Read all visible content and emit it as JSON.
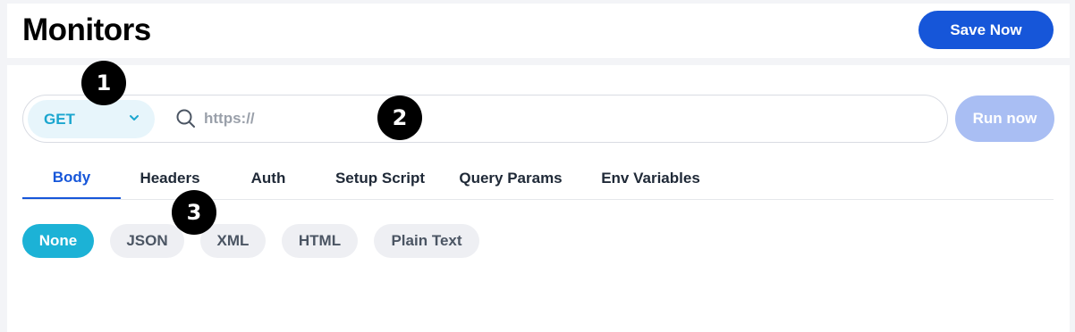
{
  "header": {
    "title": "Monitors",
    "save_label": "Save Now"
  },
  "request": {
    "method": "GET",
    "url_value": "",
    "url_placeholder": "https://",
    "run_label": "Run now"
  },
  "tabs": [
    {
      "label": "Body",
      "active": true
    },
    {
      "label": "Headers",
      "active": false
    },
    {
      "label": "Auth",
      "active": false
    },
    {
      "label": "Setup Script",
      "active": false
    },
    {
      "label": "Query Params",
      "active": false
    },
    {
      "label": "Env Variables",
      "active": false
    }
  ],
  "body_types": [
    {
      "label": "None",
      "selected": true
    },
    {
      "label": "JSON",
      "selected": false
    },
    {
      "label": "XML",
      "selected": false
    },
    {
      "label": "HTML",
      "selected": false
    },
    {
      "label": "Plain Text",
      "selected": false
    }
  ],
  "step_markers": [
    "1",
    "2",
    "3"
  ],
  "colors": {
    "primary": "#1656d9",
    "run_disabled": "#a9bef3",
    "method_accent": "#1ba6cf",
    "selected_body_type": "#1cb2d6"
  },
  "icons": {
    "search": "search-icon",
    "method_dropdown": "chevron-down-icon"
  }
}
